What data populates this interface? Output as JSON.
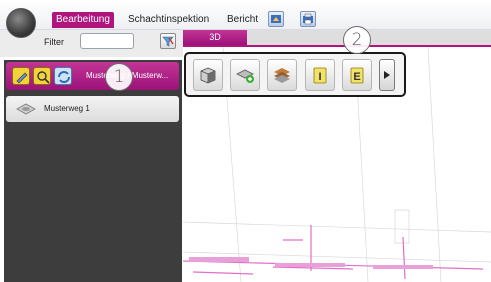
{
  "ribbon": {
    "tabs": [
      {
        "label": "Bearbeitung",
        "active": true
      },
      {
        "label": "Schachtinspektion",
        "active": false
      },
      {
        "label": "Bericht",
        "active": false
      }
    ],
    "quick_icons": [
      "report-export-icon",
      "report-print-icon"
    ]
  },
  "filter": {
    "label": "Filter",
    "value": "",
    "button_icon": "filter-clear-icon"
  },
  "left_panel": {
    "header_label": "Musterweg / Musterw...",
    "header_icons": [
      "edit-icon",
      "search-icon",
      "refresh-icon"
    ],
    "items": [
      {
        "label": "Musterweg 1",
        "icon": "manhole-icon"
      }
    ]
  },
  "view_tab": {
    "label": "3D"
  },
  "toolbar3d": {
    "buttons": [
      "box-view-icon",
      "add-manhole-icon",
      "layers-icon",
      "label-i-icon",
      "label-e-icon"
    ],
    "more_icon": "triangle-right-icon"
  },
  "callouts": [
    "1",
    "2"
  ],
  "colors": {
    "accent": "#b0157e",
    "panel_bg": "#3d3d3d",
    "drawing_lines": "#e070c8"
  }
}
